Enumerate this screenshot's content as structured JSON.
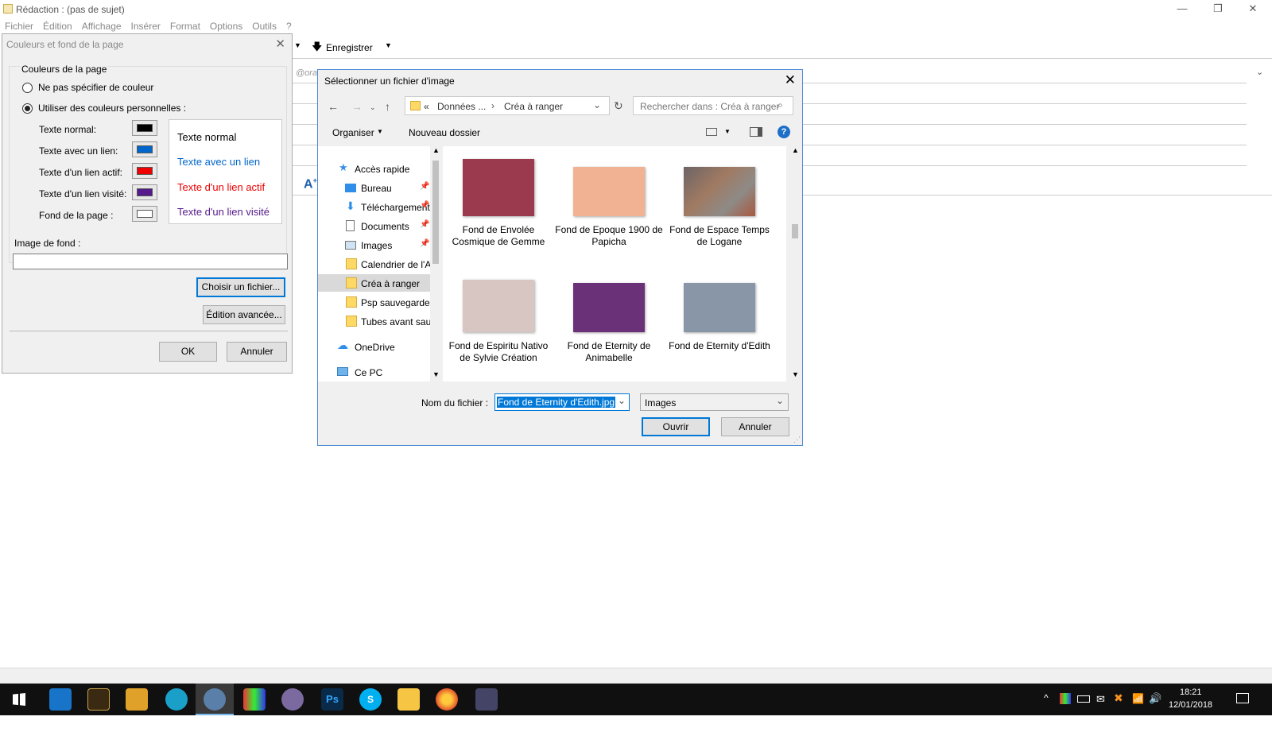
{
  "window": {
    "title": "Rédaction : (pas de sujet)",
    "min": "—",
    "max": "❐",
    "close": "✕"
  },
  "menu": [
    "Fichier",
    "Édition",
    "Affichage",
    "Insérer",
    "Format",
    "Options",
    "Outils",
    "?"
  ],
  "toolbar": {
    "save_label": "Enregistrer",
    "from_partial": "@ora"
  },
  "colors_dialog": {
    "title": "Couleurs et fond de la page",
    "group_label": "Couleurs de la page",
    "radio_none": "Ne pas spécifier de couleur",
    "radio_custom": "Utiliser des couleurs personnelles :",
    "rows": [
      {
        "label": "Texte normal:",
        "color": "#000000"
      },
      {
        "label": "Texte avec un lien:",
        "color": "#0066cc"
      },
      {
        "label": "Texte d'un lien actif:",
        "color": "#ee0000"
      },
      {
        "label": "Texte d'un lien visité:",
        "color": "#551a8b"
      },
      {
        "label": "Fond de la page :",
        "color": "#ffffff"
      }
    ],
    "preview": [
      {
        "text": "Texte normal",
        "color": "#000000"
      },
      {
        "text": "Texte avec un lien",
        "color": "#0066cc"
      },
      {
        "text": "Texte d'un lien actif",
        "color": "#ee0000"
      },
      {
        "text": "Texte d'un lien visité",
        "color": "#551a8b"
      }
    ],
    "bg_image_label": "Image de fond :",
    "choose_file": "Choisir un fichier...",
    "advanced": "Édition avancée...",
    "ok": "OK",
    "cancel": "Annuler"
  },
  "file_dialog": {
    "title": "Sélectionner un fichier d'image",
    "breadcrumb": [
      "«",
      "Données ...",
      "›",
      "Créa à ranger"
    ],
    "search_placeholder": "Rechercher dans : Créa à ranger",
    "organize": "Organiser",
    "new_folder": "Nouveau dossier",
    "nav": [
      {
        "label": "Accès rapide",
        "icon": "star-icon",
        "pinned": false
      },
      {
        "label": "Bureau",
        "icon": "desktop-icon",
        "pinned": true
      },
      {
        "label": "Téléchargements",
        "icon": "download-icon",
        "pinned": true
      },
      {
        "label": "Documents",
        "icon": "documents-icon",
        "pinned": true
      },
      {
        "label": "Images",
        "icon": "images-icon",
        "pinned": true
      },
      {
        "label": "Calendrier de l'A",
        "icon": "folder-icon",
        "pinned": false
      },
      {
        "label": "Créa à ranger",
        "icon": "folder-icon",
        "pinned": false,
        "selected": true
      },
      {
        "label": "Psp sauvegarde",
        "icon": "folder-icon",
        "pinned": false
      },
      {
        "label": "Tubes avant sau",
        "icon": "folder-icon",
        "pinned": false
      },
      {
        "label": "OneDrive",
        "icon": "cloud-icon",
        "pinned": false
      },
      {
        "label": "Ce PC",
        "icon": "computer-icon",
        "pinned": false
      }
    ],
    "files": [
      {
        "caption": "Fond de Envolée Cosmique de Gemme",
        "color": "#9b3a4e"
      },
      {
        "caption": "Fond de Epoque 1900 de Papicha",
        "color": "#f1b293"
      },
      {
        "caption": "Fond de Espace Temps de Logane",
        "color": "#8a6f63"
      },
      {
        "caption": "Fond de Espiritu Nativo de Sylvie Création",
        "color": "#d8c6c3"
      },
      {
        "caption": "Fond de Eternity de Animabelle",
        "color": "#6b3178"
      },
      {
        "caption": "Fond de Eternity d'Edith",
        "color": "#8896a7"
      }
    ],
    "filename_label": "Nom du fichier :",
    "filename_value": "Fond de Eternity d'Edith.jpg",
    "filetype": "Images",
    "open": "Ouvrir",
    "cancel": "Annuler"
  },
  "taskbar": {
    "time": "18:21",
    "date": "12/01/2018"
  }
}
